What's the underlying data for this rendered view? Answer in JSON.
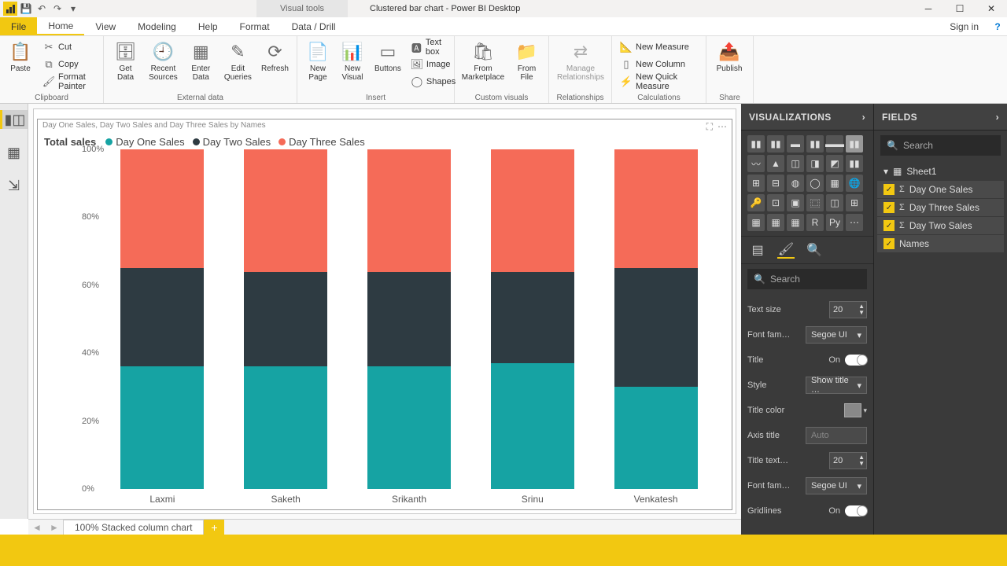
{
  "window": {
    "context_tab": "Visual tools",
    "title": "Clustered bar chart - Power BI Desktop",
    "signin": "Sign in"
  },
  "ribbon_tabs": {
    "file": "File",
    "home": "Home",
    "view": "View",
    "modeling": "Modeling",
    "help": "Help",
    "format": "Format",
    "data_drill": "Data / Drill"
  },
  "ribbon": {
    "clipboard": {
      "paste": "Paste",
      "cut": "Cut",
      "copy": "Copy",
      "format_painter": "Format Painter",
      "group": "Clipboard"
    },
    "external": {
      "get_data": "Get\nData",
      "recent": "Recent\nSources",
      "enter": "Enter\nData",
      "edit": "Edit\nQueries",
      "refresh": "Refresh",
      "group": "External data"
    },
    "insert": {
      "new_page": "New\nPage",
      "new_visual": "New\nVisual",
      "buttons": "Buttons",
      "textbox": "Text box",
      "image": "Image",
      "shapes": "Shapes",
      "group": "Insert"
    },
    "custom": {
      "market": "From\nMarketplace",
      "file": "From\nFile",
      "group": "Custom visuals"
    },
    "relationships": {
      "manage": "Manage\nRelationships",
      "group": "Relationships"
    },
    "calc": {
      "measure": "New Measure",
      "column": "New Column",
      "quick": "New Quick Measure",
      "group": "Calculations"
    },
    "share": {
      "publish": "Publish",
      "group": "Share"
    }
  },
  "visual": {
    "header": "Day One Sales, Day Two Sales and Day Three Sales by Names",
    "legend_title": "Total sales",
    "series": [
      "Day One Sales",
      "Day Two Sales",
      "Day Three Sales"
    ]
  },
  "chart_data": {
    "type": "bar",
    "stacked": "percent",
    "categories": [
      "Laxmi",
      "Saketh",
      "Srikanth",
      "Srinu",
      "Venkatesh"
    ],
    "series": [
      {
        "name": "Day One Sales",
        "values": [
          36,
          36,
          36,
          37,
          30
        ],
        "color": "#16a3a3"
      },
      {
        "name": "Day Two Sales",
        "values": [
          29,
          28,
          28,
          27,
          35
        ],
        "color": "#2e3b42"
      },
      {
        "name": "Day Three Sales",
        "values": [
          35,
          36,
          36,
          36,
          35
        ],
        "color": "#f56b58"
      }
    ],
    "title": "Total sales",
    "ylabel": "Day One Sales, Day Two Sales and Day Three Sales",
    "xlabel": "",
    "ylim": [
      0,
      100
    ],
    "yticks": [
      "0%",
      "20%",
      "40%",
      "60%",
      "80%",
      "100%"
    ]
  },
  "pagetab": "100% Stacked column chart",
  "viz_pane": {
    "title": "VISUALIZATIONS",
    "search": "Search"
  },
  "format": {
    "text_size": {
      "label": "Text size",
      "value": "20"
    },
    "font_family": {
      "label": "Font fam…",
      "value": "Segoe UI"
    },
    "title": {
      "label": "Title",
      "value": "On"
    },
    "style": {
      "label": "Style",
      "value": "Show title …"
    },
    "title_color": {
      "label": "Title color"
    },
    "axis_title": {
      "label": "Axis title",
      "placeholder": "Auto"
    },
    "title_text_size": {
      "label": "Title text…",
      "value": "20"
    },
    "font_family2": {
      "label": "Font fam…",
      "value": "Segoe UI"
    },
    "gridlines": {
      "label": "Gridlines",
      "value": "On"
    }
  },
  "fields_pane": {
    "title": "FIELDS",
    "search": "Search",
    "table": "Sheet1",
    "items": [
      "Day One Sales",
      "Day Three Sales",
      "Day Two Sales",
      "Names"
    ]
  }
}
